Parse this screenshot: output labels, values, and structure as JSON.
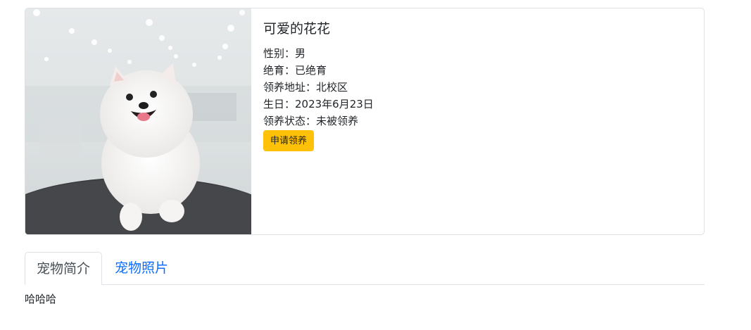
{
  "pet": {
    "name": "可爱的花花",
    "gender": "性别：男",
    "neutered": "绝育：已绝育",
    "address": "领养地址：北校区",
    "birthday": "生日：2023年6月23日",
    "status": "领养状态：未被领养",
    "adopt_button": "申请领养"
  },
  "tabs": [
    {
      "label": "宠物简介",
      "active": true
    },
    {
      "label": "宠物照片",
      "active": false
    }
  ],
  "tab_content": "哈哈哈",
  "colors": {
    "accent_button": "#ffc107",
    "link": "#0d6efd"
  }
}
